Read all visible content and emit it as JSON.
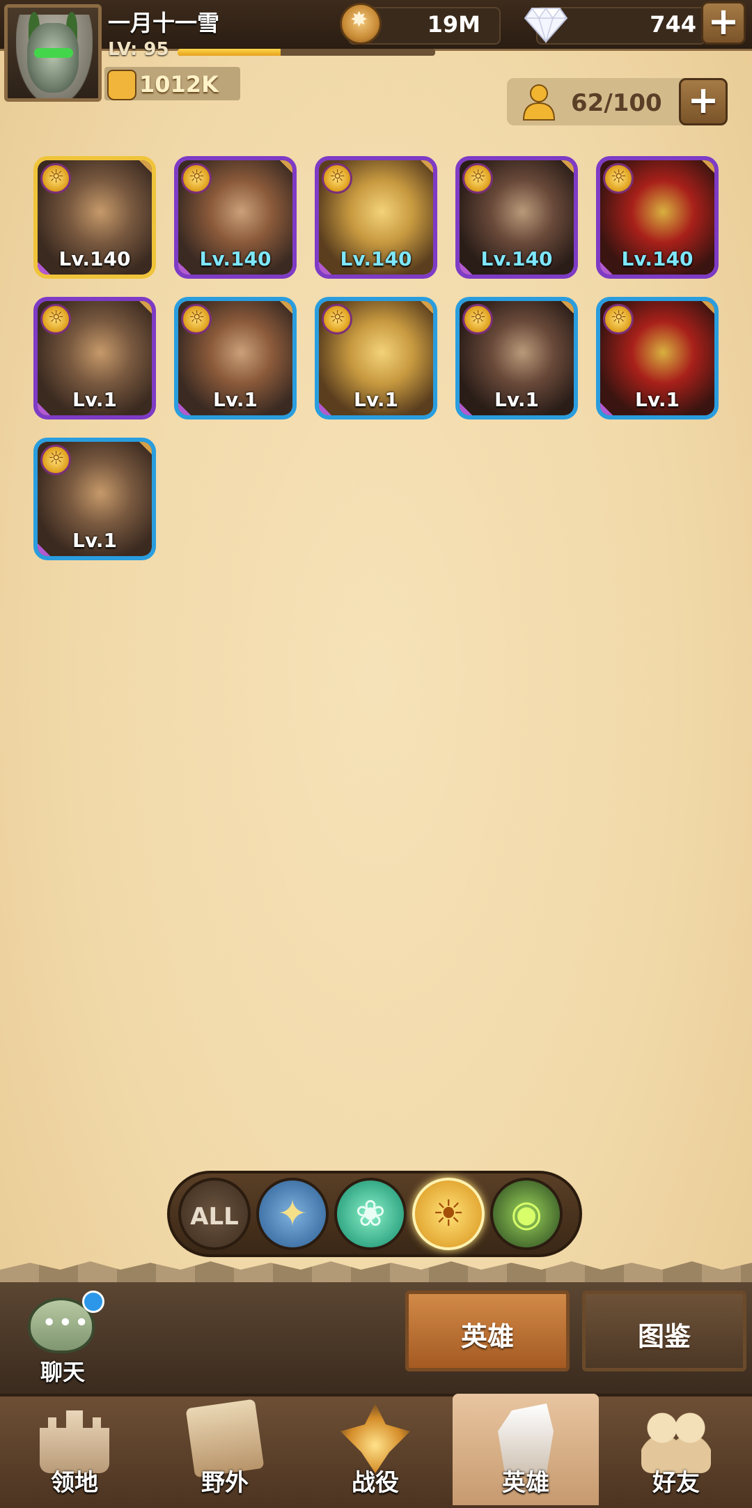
{
  "player": {
    "name": "一月十一雪",
    "level_label": "LV: 95",
    "xp_progress": 0.4,
    "power": "1012K"
  },
  "currency": {
    "gold": "19M",
    "gems": "744"
  },
  "hero_count": "62/100",
  "heroes": [
    {
      "level": "Lv.140",
      "frame": "gold",
      "level_color": "white"
    },
    {
      "level": "Lv.140",
      "frame": "purple",
      "level_color": "teal"
    },
    {
      "level": "Lv.140",
      "frame": "purple",
      "level_color": "teal"
    },
    {
      "level": "Lv.140",
      "frame": "purple",
      "level_color": "teal"
    },
    {
      "level": "Lv.140",
      "frame": "purple",
      "level_color": "teal"
    },
    {
      "level": "Lv.1",
      "frame": "purple",
      "level_color": "white"
    },
    {
      "level": "Lv.1",
      "frame": "blue",
      "level_color": "white"
    },
    {
      "level": "Lv.1",
      "frame": "blue",
      "level_color": "white"
    },
    {
      "level": "Lv.1",
      "frame": "blue",
      "level_color": "white"
    },
    {
      "level": "Lv.1",
      "frame": "blue",
      "level_color": "white"
    },
    {
      "level": "Lv.1",
      "frame": "blue",
      "level_color": "white"
    }
  ],
  "filters": {
    "all_label": "ALL",
    "items": [
      "all-filter-icon",
      "star-faction-icon",
      "lotus-faction-icon",
      "sun-faction-icon",
      "eye-faction-icon"
    ],
    "selected": "sun-faction-icon"
  },
  "chat": {
    "label": "聊天"
  },
  "subtabs": {
    "heroes": "英雄",
    "codex": "图鉴",
    "selected": "heroes"
  },
  "nav": {
    "items": [
      {
        "label": "领地",
        "icon": "castle-icon"
      },
      {
        "label": "野外",
        "icon": "map-scroll-icon"
      },
      {
        "label": "战役",
        "icon": "battle-sword-icon"
      },
      {
        "label": "英雄",
        "icon": "hero-helmet-icon"
      },
      {
        "label": "好友",
        "icon": "friends-icon"
      }
    ],
    "selected": "英雄"
  },
  "colors": {
    "frame_gold": "#f0c43a",
    "frame_purple": "#7e3bc5",
    "frame_blue": "#2a9dde",
    "level_teal": "#7ee7ff"
  }
}
